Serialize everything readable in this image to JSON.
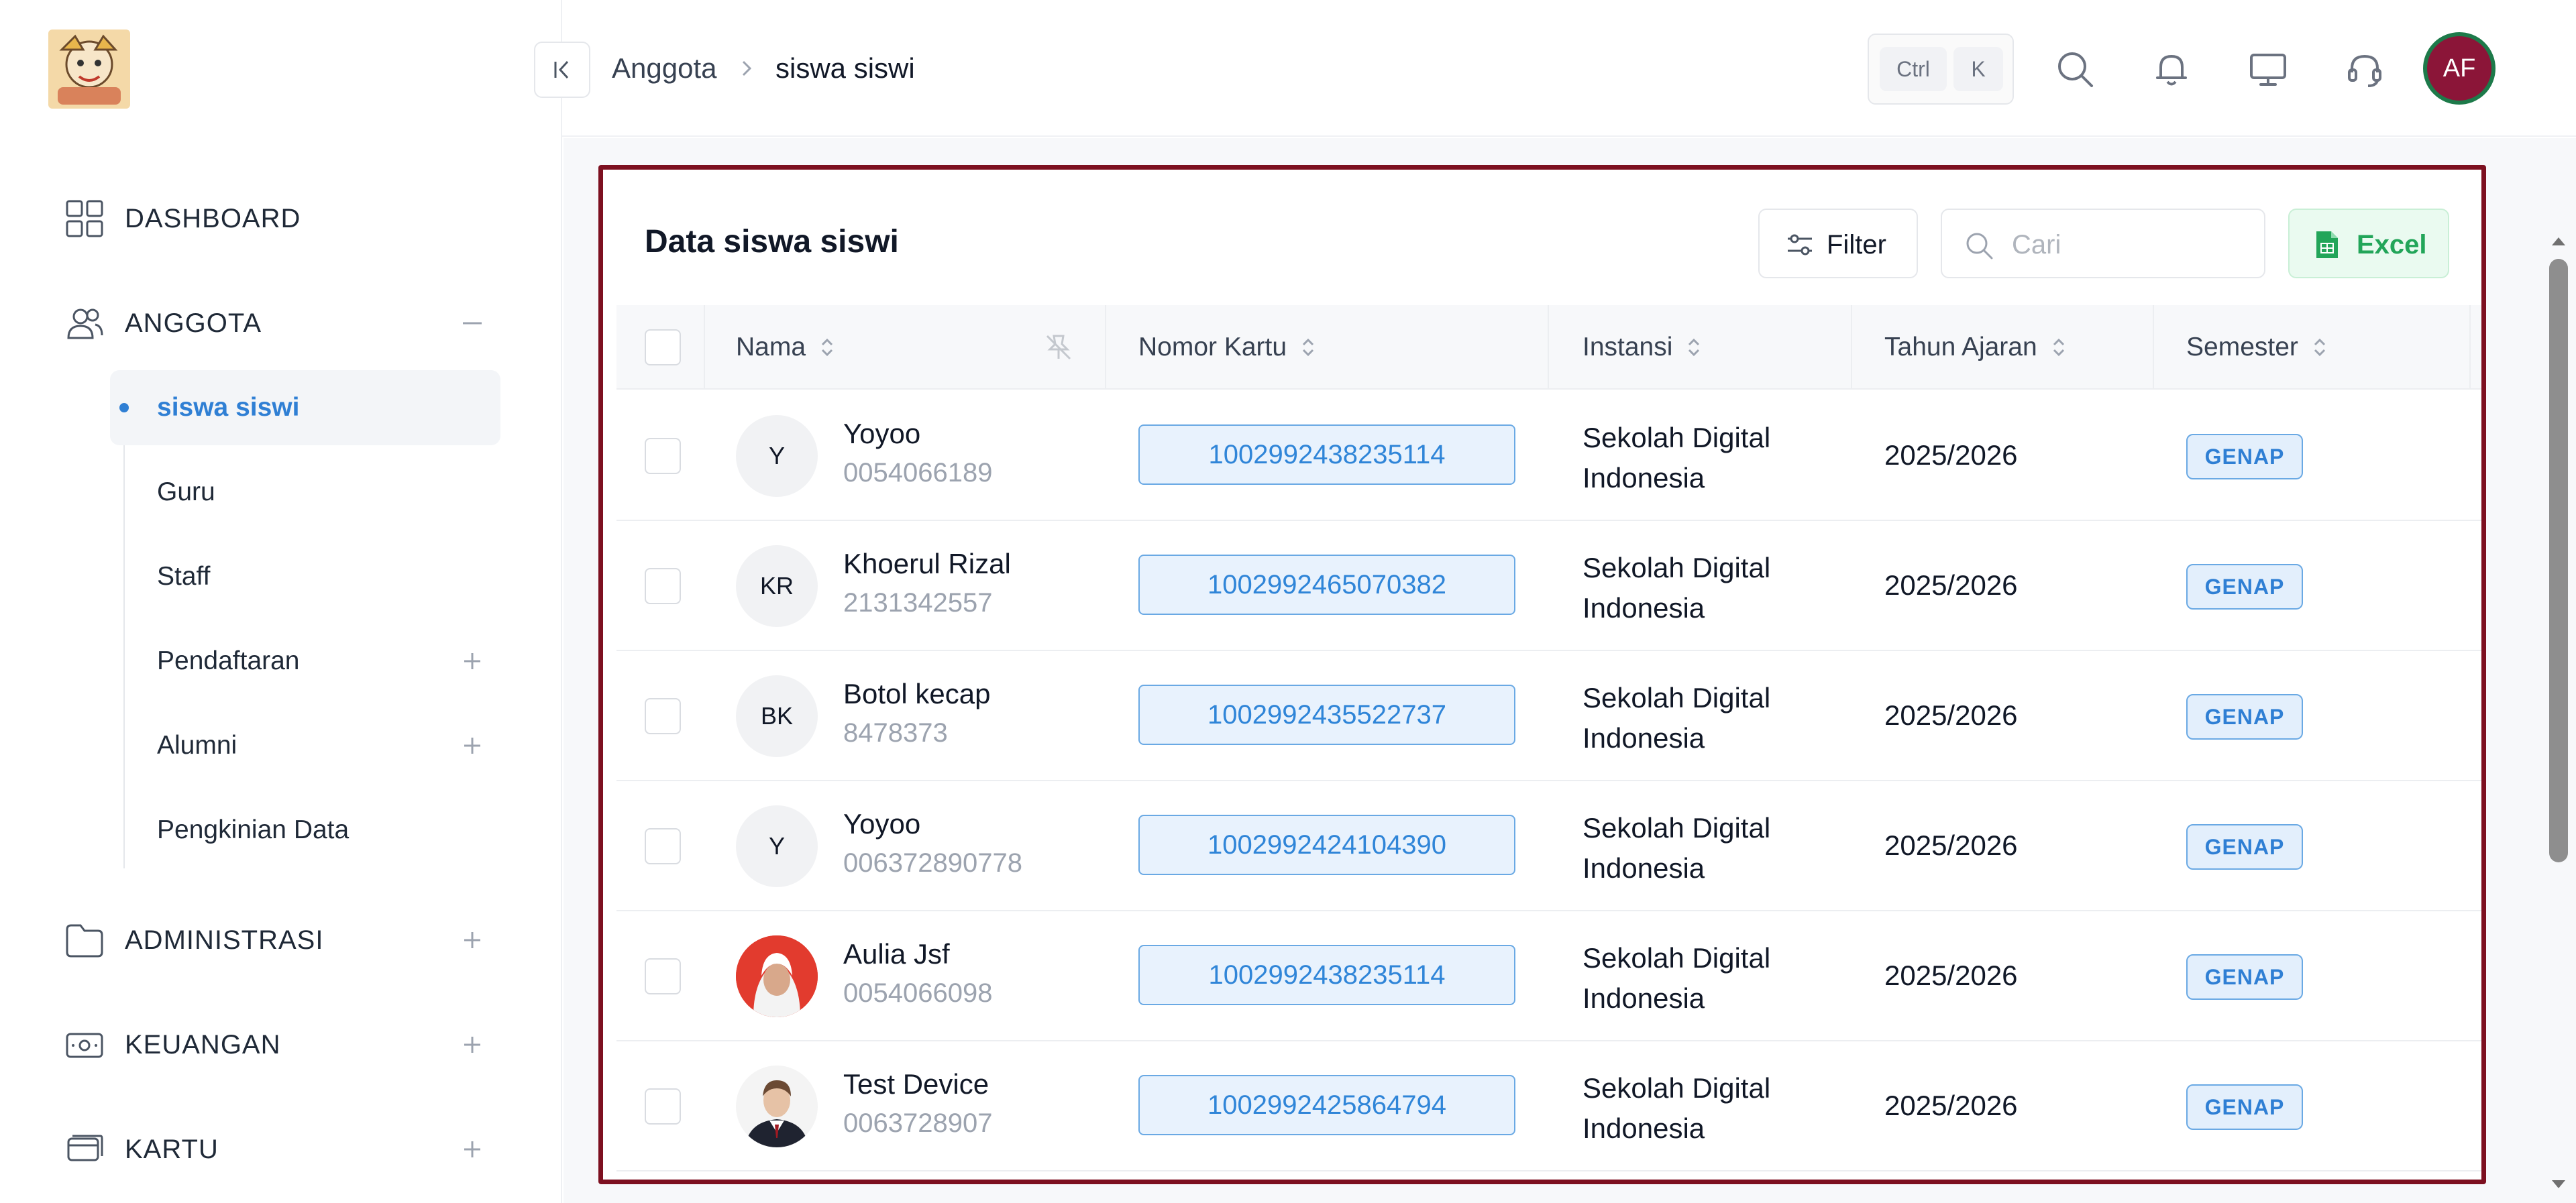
{
  "sidebar": {
    "nav": [
      {
        "label": "DASHBOARD",
        "icon": "grid-icon",
        "toggle": ""
      },
      {
        "label": "ANGGOTA",
        "icon": "users-icon",
        "toggle": "minus"
      },
      {
        "label": "ADMINISTRASI",
        "icon": "folder-icon",
        "toggle": "plus"
      },
      {
        "label": "KEUANGAN",
        "icon": "cash-icon",
        "toggle": "plus"
      },
      {
        "label": "KARTU",
        "icon": "card-icon",
        "toggle": "plus"
      }
    ],
    "anggota_sub": [
      {
        "label": "siswa siswi",
        "active": true
      },
      {
        "label": "Guru"
      },
      {
        "label": "Staff"
      },
      {
        "label": "Pendaftaran",
        "toggle": "plus"
      },
      {
        "label": "Alumni",
        "toggle": "plus"
      },
      {
        "label": "Pengkinian Data"
      }
    ]
  },
  "header": {
    "breadcrumb": [
      "Anggota",
      "siswa siswi"
    ],
    "shortcut": {
      "key1": "Ctrl",
      "key2": "K"
    },
    "user_initials": "AF",
    "accent_color": "#8b1538"
  },
  "card": {
    "title": "Data siswa siswi",
    "filter_label": "Filter",
    "search_placeholder": "Cari",
    "excel_label": "Excel",
    "columns": [
      "Nama",
      "Nomor Kartu",
      "Instansi",
      "Tahun Ajaran",
      "Semester"
    ],
    "rows": [
      {
        "initials": "Y",
        "name": "Yoyoo",
        "id": "0054066189",
        "card": "1002992438235114",
        "inst_1": "Sekolah Digital",
        "inst_2": "Indonesia",
        "year": "2025/2026",
        "semester": "GENAP",
        "next": "1",
        "photo": ""
      },
      {
        "initials": "KR",
        "name": "Khoerul Rizal",
        "id": "2131342557",
        "card": "1002992465070382",
        "inst_1": "Sekolah Digital",
        "inst_2": "Indonesia",
        "year": "2025/2026",
        "semester": "GENAP",
        "next": "1",
        "photo": ""
      },
      {
        "initials": "BK",
        "name": "Botol kecap",
        "id": "8478373",
        "card": "1002992435522737",
        "inst_1": "Sekolah Digital",
        "inst_2": "Indonesia",
        "year": "2025/2026",
        "semester": "GENAP",
        "next": "1",
        "photo": ""
      },
      {
        "initials": "Y",
        "name": "Yoyoo",
        "id": "006372890778",
        "card": "1002992424104390",
        "inst_1": "Sekolah Digital",
        "inst_2": "Indonesia",
        "year": "2025/2026",
        "semester": "GENAP",
        "next": "1",
        "photo": ""
      },
      {
        "initials": "",
        "name": "Aulia Jsf",
        "id": "0054066098",
        "card": "1002992438235114",
        "inst_1": "Sekolah Digital",
        "inst_2": "Indonesia",
        "year": "2025/2026",
        "semester": "GENAP",
        "next": "1",
        "photo": "hijab"
      },
      {
        "initials": "",
        "name": "Test Device",
        "id": "0063728907",
        "card": "1002992425864794",
        "inst_1": "Sekolah Digital",
        "inst_2": "Indonesia",
        "year": "2025/2026",
        "semester": "GENAP",
        "next": "1",
        "photo": "suit"
      }
    ]
  }
}
